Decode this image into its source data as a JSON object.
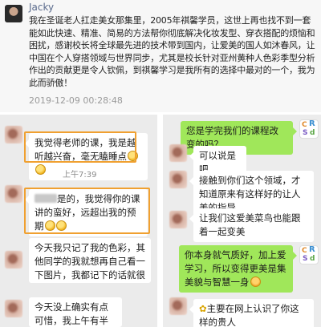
{
  "post": {
    "author": "Jacky",
    "text": "我在圣诞老人扛走美女那集里，2005年祺馨学员，这世上再也找不到一套能如此快速、精准、简易的方法帮你彻底解决化妆发型、穿衣搭配的烦恼和困扰，感谢校长将全球最先进的技术带到国内，让爱美的国人如沐春风，让中国在个人穿搭领域与世界同步，尤其是校长针对亚州黄种人色彩季型分析作出的贡献更是令人钦佩，到祺馨学习是我所有的选择中最对的一个，我为此而骄傲！",
    "time": "2019-12-09 00:28:48"
  },
  "left_chat": {
    "msg1": "我觉得老师的课，我是越听越兴奋，毫无瞌睡点",
    "time1": "上午7:39",
    "msg2": "是的，我觉得你的课讲的蛮好，远超出我的预期",
    "msg3": "今天我只记了我的色彩，其他同学的我就想再自己看一下图片，我都记下的话就很容易干扰我自己判断了嘛，所以我就没记，",
    "msg4": "今天没上确实有点可惜，我上午有半小时没有"
  },
  "right_chat": {
    "msg1": "您是学完我们的课程改变的吗？",
    "msg2": "可以说是吧",
    "msg3": "接触到你们这个领域，才知道原来有这样好的让人美的指导",
    "msg4": "让我们这爱美菜鸟也能跟着一起变美",
    "msg5": "你本身就气质好，加上爱学习，所以变得更美是集美貌与智慧一身",
    "msg6": "主要在网上认识了你这样的贵人"
  }
}
